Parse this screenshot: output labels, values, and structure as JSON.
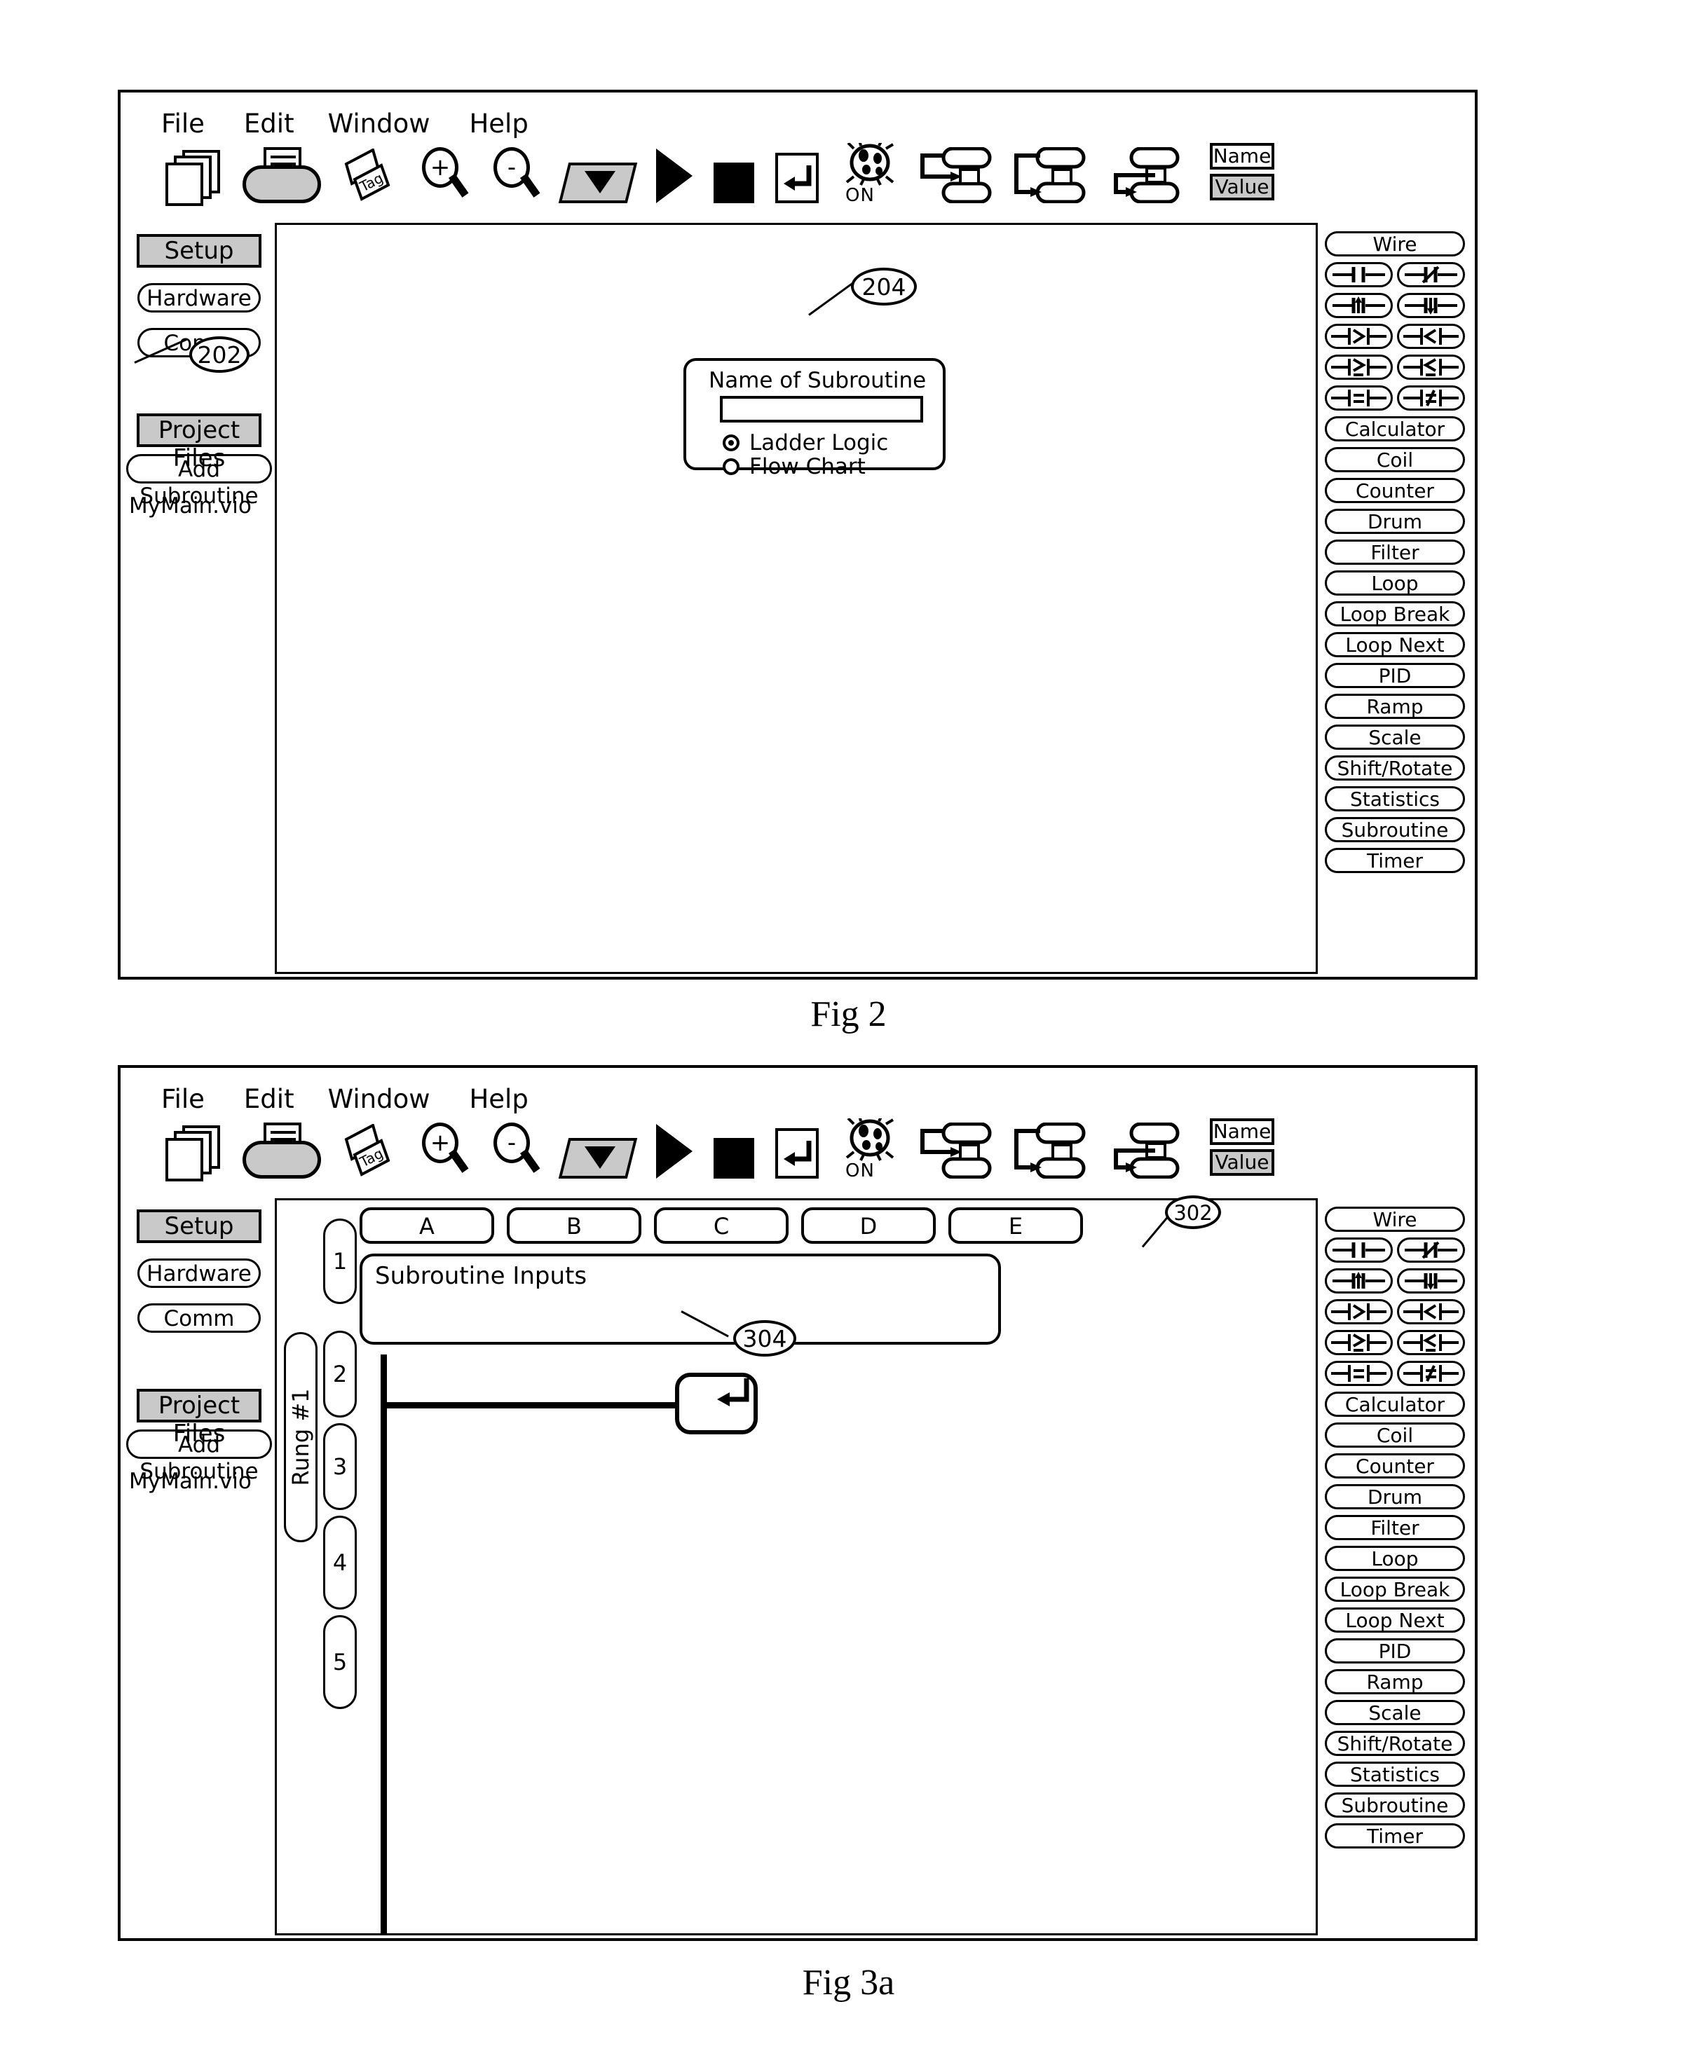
{
  "menu": {
    "items": [
      "File",
      "Edit",
      "Window",
      "Help"
    ]
  },
  "toolbar": {
    "icons": [
      "documents-icon",
      "save-icon",
      "tag-icon",
      "zoom-in-icon",
      "zoom-out-icon",
      "dropdown-icon",
      "run-icon",
      "stop-icon",
      "return-icon",
      "debug-on-icon",
      "flowchart-branch-icon",
      "flowchart-split-icon",
      "flowchart-merge-icon"
    ],
    "zoom_in_sign": "+",
    "zoom_out_sign": "-",
    "debug_label": "ON",
    "name_label": "Name",
    "value_label": "Value"
  },
  "sidebar": {
    "setup_header": "Setup",
    "setup_items": [
      "Hardware",
      "Comm"
    ],
    "project_header": "Project Files",
    "add_subroutine": "Add Subroutine",
    "files": [
      "MyMain.vio"
    ]
  },
  "palette": {
    "wire": "Wire",
    "symbols": [
      [
        "contact-no",
        "contact-nc"
      ],
      [
        "contact-rising-edge",
        "contact-falling-edge"
      ],
      [
        "compare-greater",
        "compare-less"
      ],
      [
        "compare-greater-equal",
        "compare-less-equal"
      ],
      [
        "compare-equal",
        "compare-not-equal"
      ]
    ],
    "blocks": [
      "Calculator",
      "Coil",
      "Counter",
      "Drum",
      "Filter",
      "Loop",
      "Loop Break",
      "Loop Next",
      "PID",
      "Ramp",
      "Scale",
      "Shift/Rotate",
      "Statistics",
      "Subroutine",
      "Timer"
    ]
  },
  "fig2": {
    "caption": "Fig 2",
    "dialog": {
      "title": "Name of Subroutine",
      "input_value": "",
      "options": [
        {
          "label": "Ladder Logic",
          "selected": true
        },
        {
          "label": "Flow Chart",
          "selected": false
        }
      ]
    },
    "callouts": [
      {
        "id": "202",
        "target": "add-subroutine-button"
      },
      {
        "id": "204",
        "target": "subroutine-dialog"
      }
    ]
  },
  "fig3a": {
    "caption": "Fig 3a",
    "tabs": [
      "A",
      "B",
      "C",
      "D",
      "E"
    ],
    "inputs_panel_label": "Subroutine Inputs",
    "rung_label": "Rung #1",
    "row_numbers": [
      "1",
      "2",
      "3",
      "4",
      "5"
    ],
    "callouts": [
      {
        "id": "302",
        "target": "tab-e"
      },
      {
        "id": "304",
        "target": "inputs-panel"
      }
    ]
  }
}
